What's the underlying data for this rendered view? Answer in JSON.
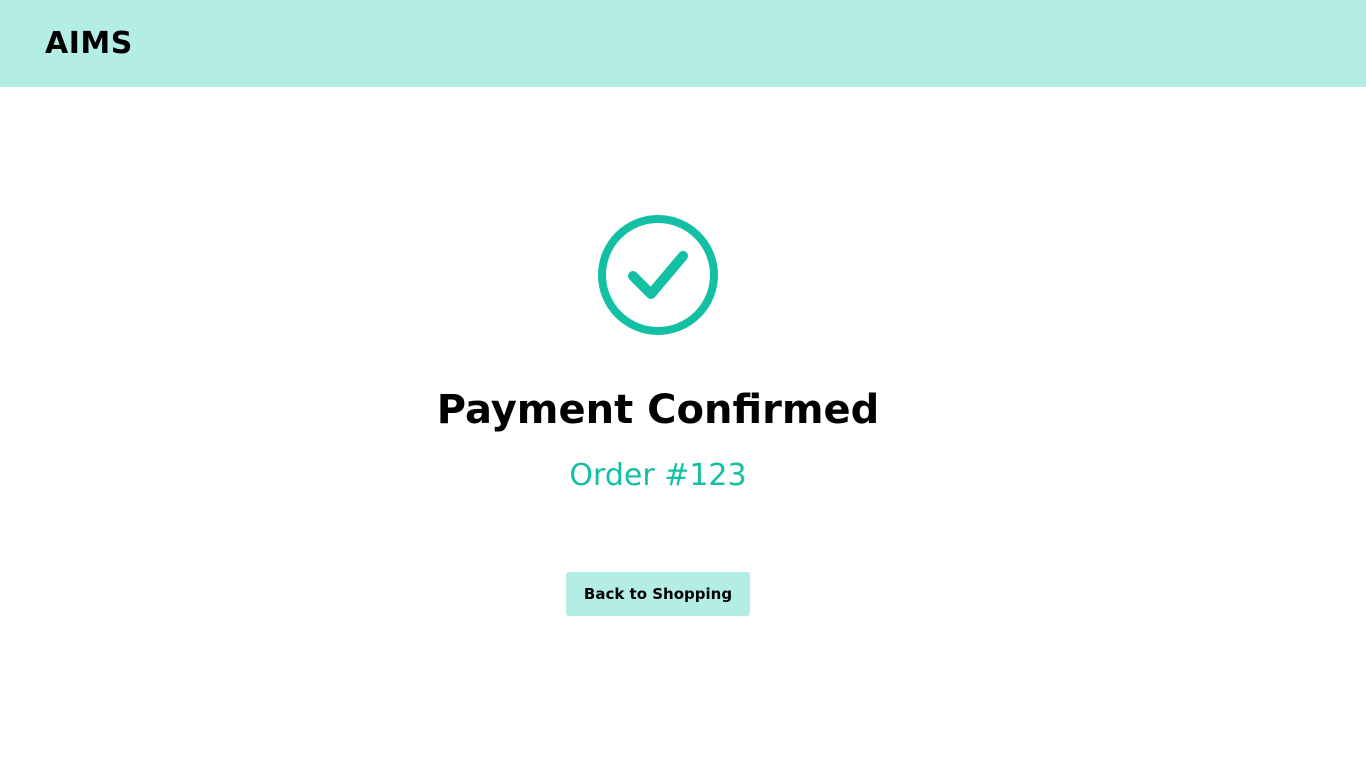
{
  "header": {
    "brand": "AIMS"
  },
  "confirmation": {
    "icon": "check-circle-icon",
    "title": "Payment Confirmed",
    "order_label": "Order #123",
    "back_button_label": "Back to Shopping"
  },
  "colors": {
    "header_bg": "#b4ede3",
    "accent": "#14c0a4",
    "button_bg": "#b4ede3",
    "text": "#000000"
  }
}
